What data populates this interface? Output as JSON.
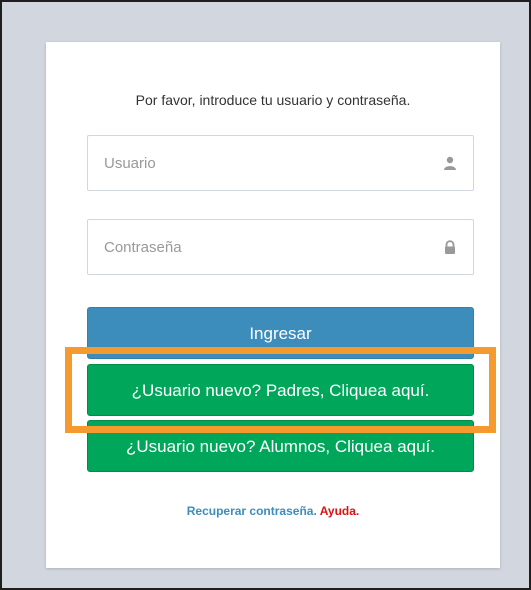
{
  "login": {
    "message": "Por favor, introduce tu usuario y contraseña.",
    "username_placeholder": "Usuario",
    "password_placeholder": "Contraseña",
    "username_icon": "user-icon",
    "password_icon": "lock-icon",
    "submit_label": "Ingresar",
    "new_parent_label": "¿Usuario nuevo? Padres, Cliquea aquí.",
    "new_student_label": "¿Usuario nuevo? Alumnos, Cliquea aquí.",
    "recover_label": "Recuperar contraseña.",
    "help_label": "Ayuda."
  },
  "colors": {
    "primary": "#3c8dbc",
    "success": "#00a65a",
    "help_red": "#dd1111",
    "highlight": "#f59a2e",
    "background": "#d2d6de"
  }
}
